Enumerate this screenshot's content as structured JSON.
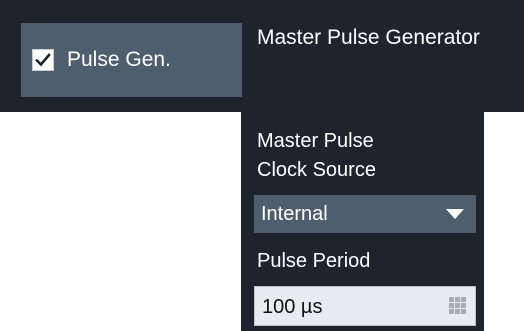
{
  "header": {
    "pulse_gen_label": "Pulse Gen.",
    "pulse_gen_checked": true,
    "section_title": "Master Pulse Generator"
  },
  "clock_source": {
    "label_line1": "Master Pulse",
    "label_line2": "Clock Source",
    "value": "Internal"
  },
  "pulse_period": {
    "label": "Pulse Period",
    "value": "100 µs"
  },
  "icons": {
    "checkbox": "checkmark-icon",
    "dropdown": "triangle-down-icon",
    "keypad": "keypad-icon"
  },
  "colors": {
    "panel_background": "#1e242b",
    "button_background": "#4e5e6c",
    "input_background": "#e6ecef",
    "text_light": "#ffffff",
    "text_dark": "#111111"
  }
}
